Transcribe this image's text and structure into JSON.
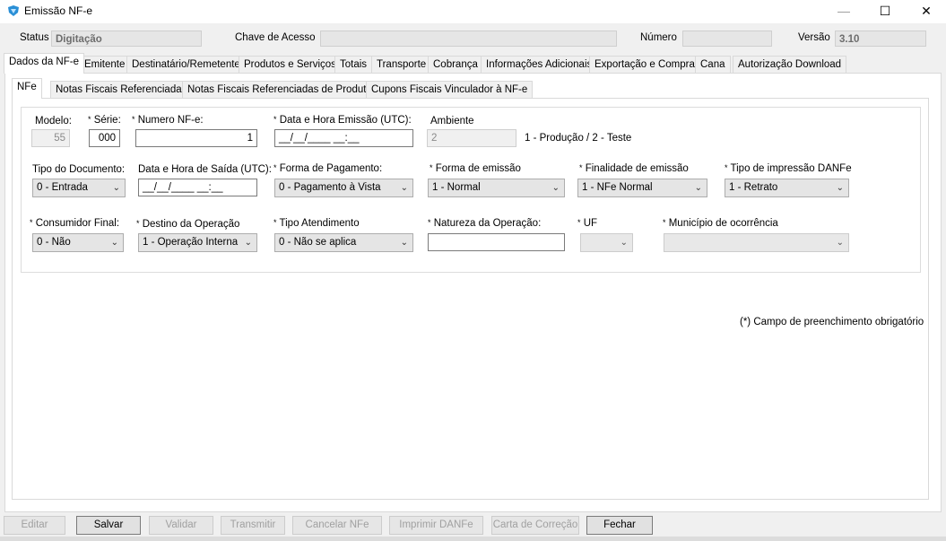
{
  "window": {
    "title": "Emissão NF-e",
    "icon": "app-icon"
  },
  "header": {
    "status_label": "Status",
    "status_value": "Digitação",
    "chave_label": "Chave de Acesso",
    "chave_value": "",
    "numero_label": "Número",
    "numero_value": "",
    "versao_label": "Versão",
    "versao_value": "3.10"
  },
  "main_tabs": [
    "Dados da NF-e",
    "Emitente",
    "Destinatário/Remetente",
    "Produtos e Serviços",
    "Totais",
    "Transporte",
    "Cobrança",
    "Informações Adicionais",
    "Exportação e Compras",
    "Cana",
    "Autorização Download"
  ],
  "sub_tabs": [
    "NFe",
    "Notas Fiscais Referenciadas",
    "Notas Fiscais Referenciadas de Produtor",
    "Cupons Fiscais Vinculador à NF-e"
  ],
  "form": {
    "modelo_label": "Modelo:",
    "modelo_value": "55",
    "serie_label": "Série:",
    "serie_value": "000",
    "numero_nfe_label": "Numero NF-e:",
    "numero_nfe_value": "1",
    "data_emissao_label": "Data e Hora Emissão (UTC):",
    "data_emissao_value": "__/__/____ __:__",
    "ambiente_label": "Ambiente",
    "ambiente_value": "2",
    "ambiente_hint": "1 - Produção / 2 - Teste",
    "tipo_documento_label": "Tipo do Documento:",
    "tipo_documento_value": "0 - Entrada",
    "data_saida_label": "Data e Hora de Saída (UTC):",
    "data_saida_value": "__/__/____ __:__",
    "forma_pagamento_label": "Forma de Pagamento:",
    "forma_pagamento_value": "0 - Pagamento à Vista",
    "forma_emissao_label": "Forma de emissão",
    "forma_emissao_value": "1 - Normal",
    "finalidade_label": "Finalidade de emissão",
    "finalidade_value": "1 - NFe Normal",
    "tipo_impressao_label": "Tipo de impressão DANFe",
    "tipo_impressao_value": "1 - Retrato",
    "consumidor_label": "Consumidor Final:",
    "consumidor_value": "0 - Não",
    "destino_label": "Destino da Operação",
    "destino_value": "1 - Operação Interna",
    "atendimento_label": "Tipo Atendimento",
    "atendimento_value": "0 - Não se aplica",
    "natureza_label": "Natureza da Operação:",
    "natureza_value": "",
    "uf_label": "UF",
    "uf_value": "",
    "municipio_label": "Município de ocorrência",
    "municipio_value": "",
    "required_marker": "*",
    "required_note": "(*) Campo de preenchimento obrigatório"
  },
  "buttons": {
    "editar": "Editar",
    "salvar": "Salvar",
    "validar": "Validar",
    "transmitir": "Transmitir",
    "cancelar": "Cancelar NFe",
    "imprimir": "Imprimir DANFe",
    "carta": "Carta de Correção",
    "fechar": "Fechar"
  }
}
